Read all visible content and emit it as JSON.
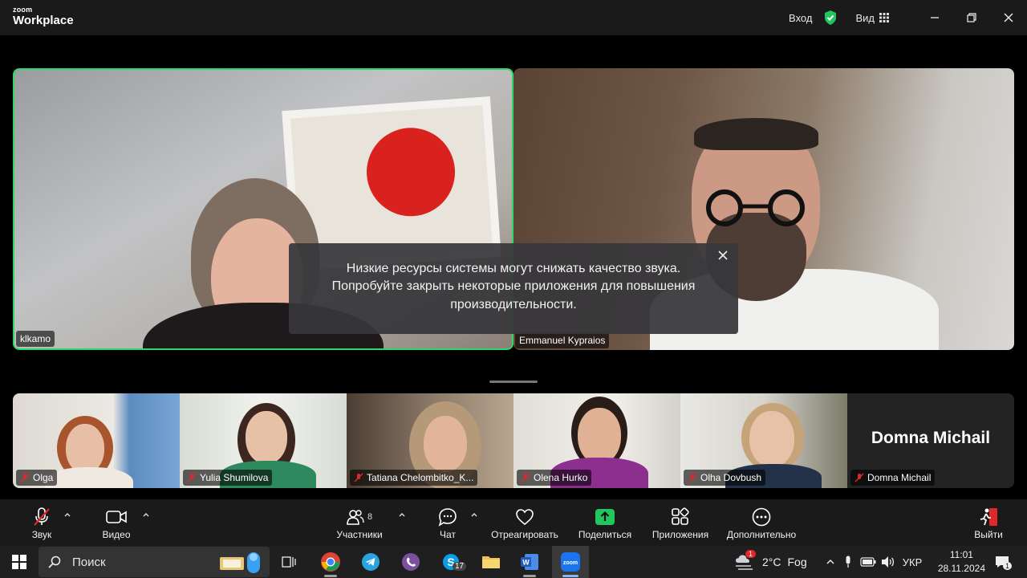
{
  "app": {
    "brand_top": "zoom",
    "brand_name": "Workplace",
    "signin": "Вход",
    "view": "Вид"
  },
  "main_tiles": [
    {
      "name": "klkamo"
    },
    {
      "name": "Emmanuel Kypraios"
    }
  ],
  "notification": {
    "text": "Низкие ресурсы системы могут снижать качество звука. Попробуйте закрыть некоторые приложения для повышения производительности."
  },
  "thumbnails": [
    {
      "name": "Olga",
      "muted": true
    },
    {
      "name": "Yulia Shumilova",
      "muted": true
    },
    {
      "name": "Tatiana Chelombitko_K...",
      "muted": true
    },
    {
      "name": "Olena Hurko",
      "muted": true
    },
    {
      "name": "Olha Dovbush",
      "muted": true
    },
    {
      "name": "Domna Michail",
      "muted": true,
      "display_name": "Domna Michail"
    }
  ],
  "toolbar": {
    "audio": "Звук",
    "video": "Видео",
    "participants": "Участники",
    "participants_count": "8",
    "chat": "Чат",
    "react": "Отреагировать",
    "share": "Поделиться",
    "apps": "Приложения",
    "more": "Дополнительно",
    "leave": "Выйти"
  },
  "taskbar": {
    "search_placeholder": "Поиск",
    "skype_badge": "17",
    "weather_temp": "2°C",
    "weather_desc": "Fog",
    "weather_badge": "1",
    "language": "УКР",
    "time": "11:01",
    "date": "28.11.2024",
    "notif_count": "1"
  },
  "colors": {
    "active_speaker": "#2bd96b",
    "share_green": "#22c55e",
    "leave_red": "#e02828",
    "muted_red": "#e02828"
  }
}
